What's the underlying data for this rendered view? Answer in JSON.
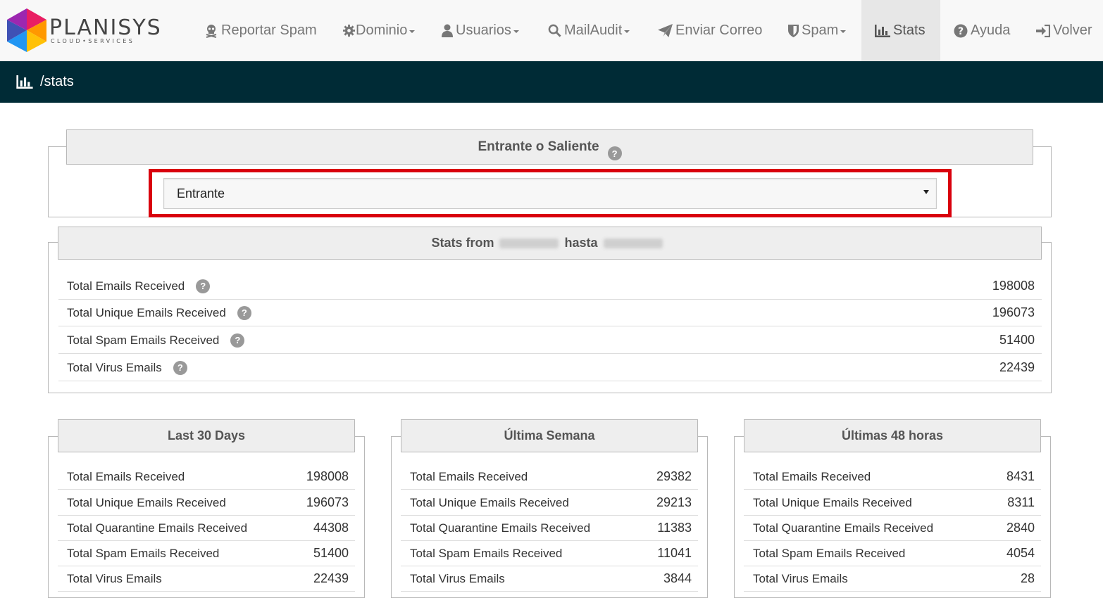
{
  "brand": {
    "name": "PLANISYS",
    "tagline": "CLOUD•SERVICES"
  },
  "nav": [
    {
      "label": "Reportar Spam",
      "icon": "skull-icon",
      "dropdown": false
    },
    {
      "label": "Dominio",
      "icon": "gear-icon",
      "dropdown": true
    },
    {
      "label": "Usuarios",
      "icon": "user-icon",
      "dropdown": true
    },
    {
      "label": "MailAudit",
      "icon": "search-icon",
      "dropdown": true
    },
    {
      "label": "Enviar Correo",
      "icon": "send-icon",
      "dropdown": false
    },
    {
      "label": "Spam",
      "icon": "shield-icon",
      "dropdown": true
    },
    {
      "label": "Stats",
      "icon": "bar-chart-icon",
      "dropdown": false,
      "active": true
    },
    {
      "label": "Ayuda",
      "icon": "question-icon",
      "dropdown": false
    },
    {
      "label": "Volver",
      "icon": "sign-in-icon",
      "dropdown": false
    }
  ],
  "breadcrumb": {
    "path": "/stats",
    "icon": "bar-chart-icon"
  },
  "direction": {
    "title": "Entrante o Saliente",
    "selected": "Entrante"
  },
  "overall": {
    "title_from": "Stats from",
    "title_to": "hasta",
    "rows": [
      {
        "label": "Total Emails Received",
        "value": "198008"
      },
      {
        "label": "Total Unique Emails Received",
        "value": "196073"
      },
      {
        "label": "Total Spam Emails Received",
        "value": "51400"
      },
      {
        "label": "Total Virus Emails",
        "value": "22439"
      }
    ]
  },
  "periods": [
    {
      "title": "Last 30 Days",
      "rows": [
        {
          "label": "Total Emails Received",
          "value": "198008"
        },
        {
          "label": "Total Unique Emails Received",
          "value": "196073"
        },
        {
          "label": "Total Quarantine Emails Received",
          "value": "44308"
        },
        {
          "label": "Total Spam Emails Received",
          "value": "51400"
        },
        {
          "label": "Total Virus Emails",
          "value": "22439"
        }
      ]
    },
    {
      "title": "Última Semana",
      "rows": [
        {
          "label": "Total Emails Received",
          "value": "29382"
        },
        {
          "label": "Total Unique Emails Received",
          "value": "29213"
        },
        {
          "label": "Total Quarantine Emails Received",
          "value": "11383"
        },
        {
          "label": "Total Spam Emails Received",
          "value": "11041"
        },
        {
          "label": "Total Virus Emails",
          "value": "3844"
        }
      ]
    },
    {
      "title": "Últimas 48 horas",
      "rows": [
        {
          "label": "Total Emails Received",
          "value": "8431"
        },
        {
          "label": "Total Unique Emails Received",
          "value": "8311"
        },
        {
          "label": "Total Quarantine Emails Received",
          "value": "2840"
        },
        {
          "label": "Total Spam Emails Received",
          "value": "4054"
        },
        {
          "label": "Total Virus Emails",
          "value": "28"
        }
      ]
    }
  ],
  "help_glyph": "?"
}
